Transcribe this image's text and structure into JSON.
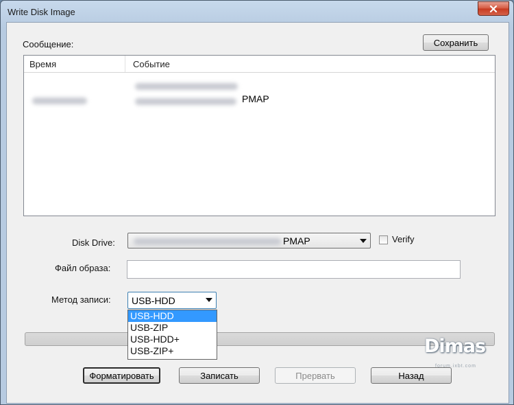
{
  "window": {
    "title": "Write Disk Image",
    "close_icon": "close-icon"
  },
  "messages": {
    "label": "Сообщение:",
    "save_label": "Сохранить",
    "columns": [
      "Время",
      "Событие"
    ],
    "rows": [
      {
        "time": "",
        "event": "PMAP"
      }
    ]
  },
  "form": {
    "disk_drive_label": "Disk Drive:",
    "disk_drive_value": "PMAP",
    "verify_label": "Verify",
    "verify_checked": false,
    "image_file_label": "Файл образа:",
    "image_file_value": "",
    "write_method_label": "Метод записи:",
    "write_method_value": "USB-HDD",
    "write_method_options": [
      "USB-HDD",
      "USB-ZIP",
      "USB-HDD+",
      "USB-ZIP+"
    ],
    "write_method_selected_index": 0,
    "progress": 0
  },
  "buttons": {
    "format_label": "Форматировать",
    "write_label": "Записать",
    "abort_label": "Прервать",
    "back_label": "Назад"
  },
  "watermark": {
    "text": "Dimas",
    "sub": "forum.ixbt.com"
  }
}
